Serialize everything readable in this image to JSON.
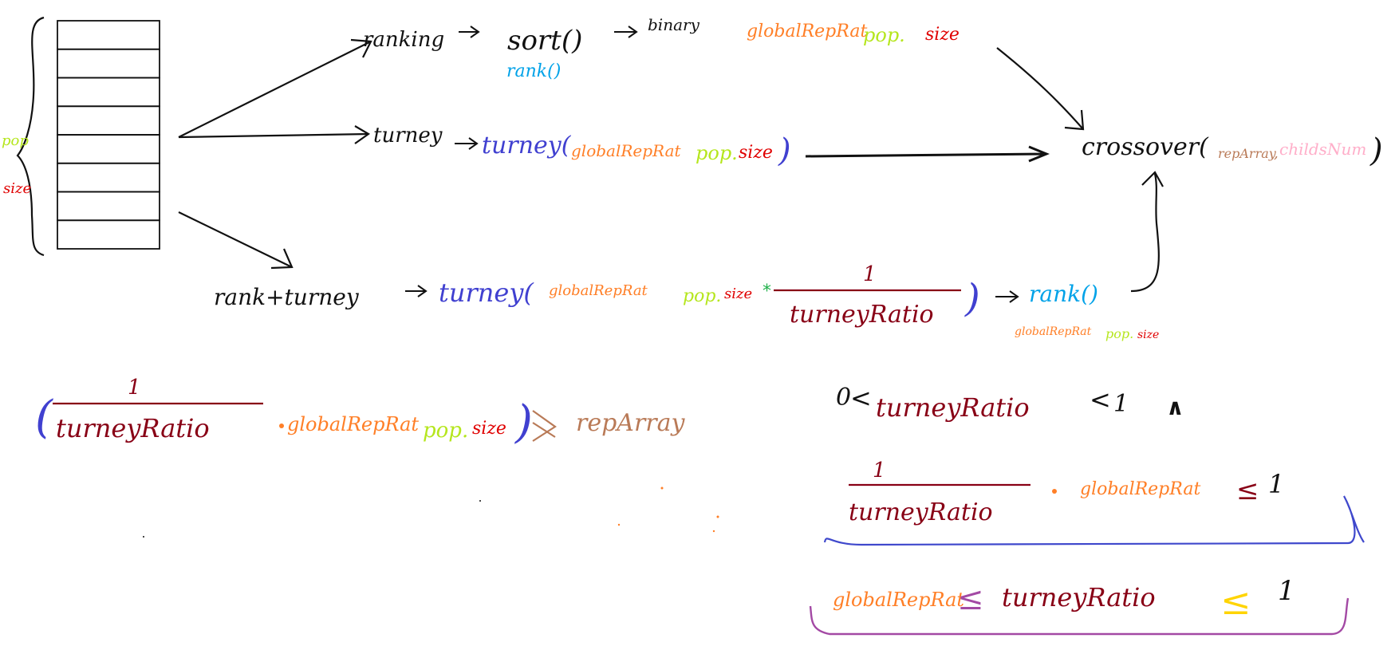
{
  "colors": {
    "ink": "#111111",
    "orange": "#ff7f27",
    "lime": "#b5e61d",
    "red": "#e00000",
    "blue": "#4040d0",
    "sky": "#00a2e8",
    "brown": "#b97a57",
    "pink": "#ffaec9",
    "maroon": "#880015",
    "green": "#22b14c",
    "purple": "#a349a4",
    "yellow": "#ffd400",
    "royal": "#3f48cc"
  },
  "population": {
    "label_pop": "pop",
    "label_size": "size",
    "rows": 8
  },
  "ranking": {
    "name": "ranking",
    "sort": "sort()",
    "rank": "rank()",
    "binary": "binary",
    "global": "globalRepRat",
    "pop": "pop.",
    "size": "size"
  },
  "turney": {
    "name": "turney",
    "func": "turney(",
    "global": "globalRepRat",
    "pop": "pop.",
    "size": "size",
    "close": ")"
  },
  "rankturney": {
    "name": "rank+turney",
    "func": "turney(",
    "global": "globalRepRat",
    "pop": "pop.",
    "size": "size",
    "one": "1",
    "ratio": "turneyRatio",
    "close": ")",
    "rank": "rank()",
    "sub_global": "globalRepRat",
    "sub_pop": "pop.",
    "sub_size": "size"
  },
  "crossover": {
    "name": "crossover(",
    "rep": "repArray",
    "comma": ",",
    "childs": "childsNum",
    "close": ")"
  },
  "formula_left": {
    "one": "1",
    "ratio": "turneyRatio",
    "global": "globalRepRat",
    "pop": "pop.",
    "size": "size",
    "result": "repArray"
  },
  "constraint1": {
    "zero": "0",
    "lt1": "<",
    "ratio": "turneyRatio",
    "lt2": "<",
    "one": "1",
    "and": "∧"
  },
  "constraint2": {
    "one": "1",
    "ratio": "turneyRatio",
    "global": "globalRepRat",
    "le": "≤",
    "rhs": "1"
  },
  "constraint3": {
    "global": "globalRepRat",
    "le1": "≤",
    "ratio": "turneyRatio",
    "le2": "≤",
    "rhs": "1"
  }
}
